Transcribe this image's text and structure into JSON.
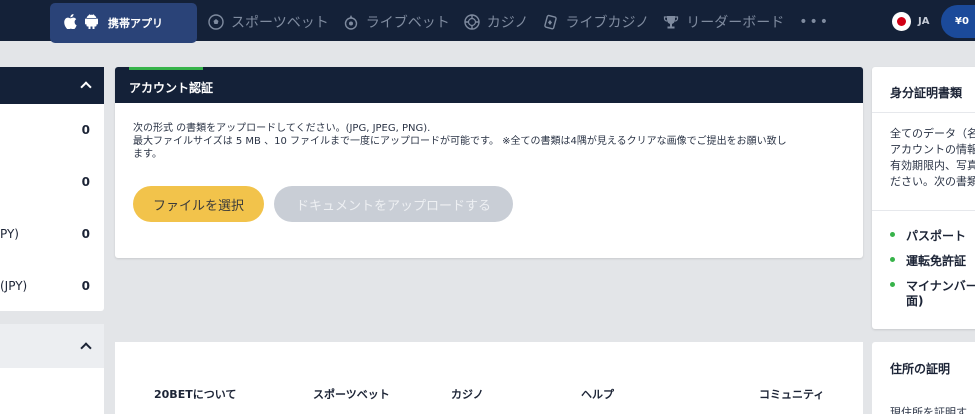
{
  "header": {
    "mobile_app_label": "携帯アプリ",
    "nav_items": [
      {
        "label": "スポーツベット",
        "icon": "soccer-ball-icon"
      },
      {
        "label": "ライブベット",
        "icon": "live-bet-icon"
      },
      {
        "label": "カジノ",
        "icon": "casino-chip-icon"
      },
      {
        "label": "ライブカジノ",
        "icon": "cards-icon"
      },
      {
        "label": "リーダーボード",
        "icon": "trophy-icon"
      }
    ],
    "more": "•••",
    "language_code": "JA",
    "balance": "¥0"
  },
  "left_panel": {
    "rows": [
      {
        "label": "",
        "value": "0"
      },
      {
        "label": "",
        "value": "0"
      },
      {
        "label": "PY)",
        "value": "0"
      },
      {
        "label": "(JPY)",
        "value": "0"
      }
    ]
  },
  "verification": {
    "title": "アカウント認証",
    "instructions": [
      "次の形式 の書類をアップロードしてください。(JPG, JPEG, PNG).",
      "最大ファイルサイズは 5 MB 、10 ファイルまで一度にアップロードが可能です。 ※全ての書類は4隅が見えるクリアな画像でご提出をお願い致し",
      "ます。"
    ],
    "choose_file_label": "ファイルを選択",
    "upload_label": "ドキュメントをアップロードする"
  },
  "footer": {
    "links": [
      "20BETについて",
      "スポーツベット",
      "カジノ",
      "ヘルプ",
      "コミュニティ"
    ]
  },
  "id_docs": {
    "title": "身分証明書類",
    "description": [
      "全てのデータ（名",
      "アカウントの情報",
      "有効期限内、写真",
      "ださい。次の書類"
    ],
    "items": [
      "パスポート",
      "運転免許証",
      "マイナンバー",
      "面)"
    ]
  },
  "address_proof": {
    "title": "住所の証明",
    "description": "現住所を証明す"
  },
  "colors": {
    "navy": "#142138",
    "accent_green": "#37b34a",
    "choose_button": "#f2c34b",
    "upload_button_disabled": "#c9ced6"
  }
}
